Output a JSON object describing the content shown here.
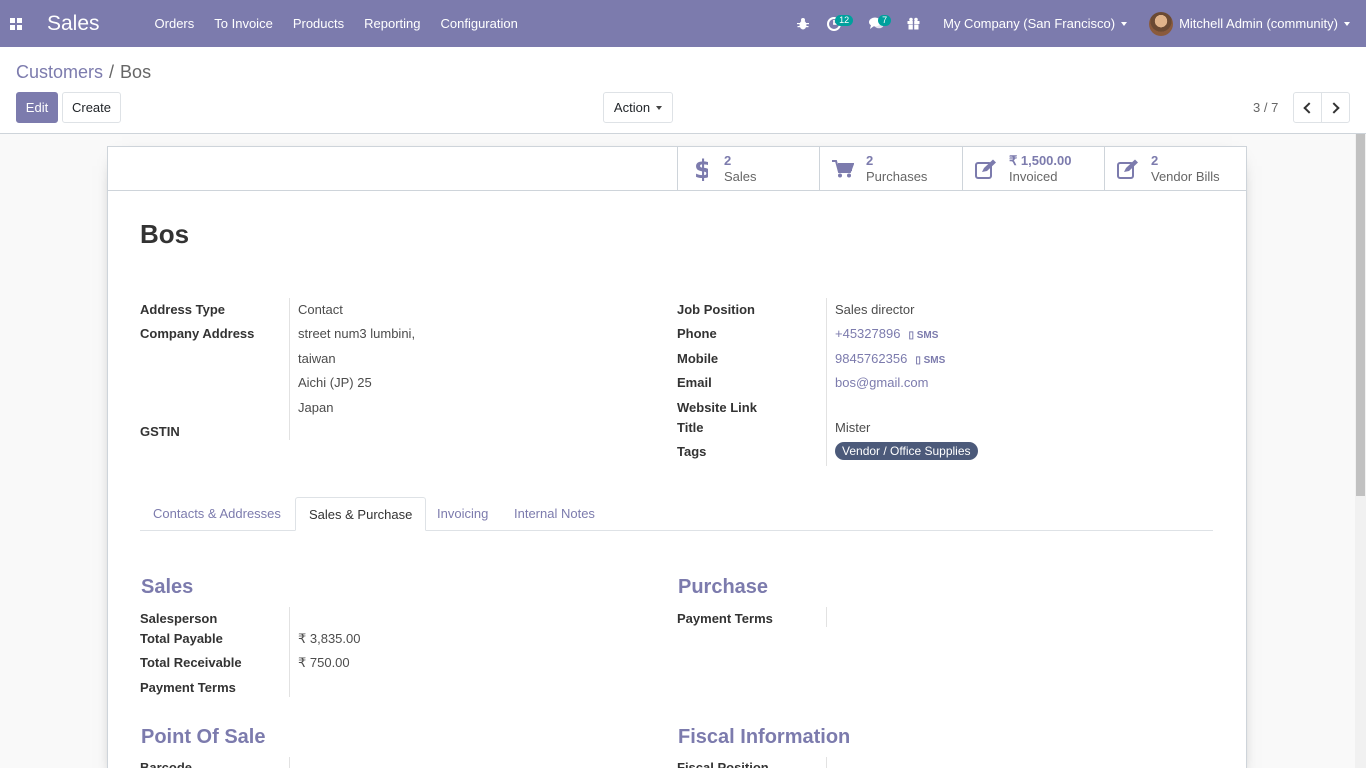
{
  "navbar": {
    "app_name": "Sales",
    "menu": [
      "Orders",
      "To Invoice",
      "Products",
      "Reporting",
      "Configuration"
    ],
    "activity_badge": "12",
    "messages_badge": "7",
    "company": "My Company (San Francisco)",
    "user": "Mitchell Admin (community)"
  },
  "breadcrumb": {
    "parent": "Customers",
    "separator": "/",
    "current": "Bos"
  },
  "toolbar": {
    "edit": "Edit",
    "create": "Create",
    "action": "Action"
  },
  "pager": {
    "value": "3 / 7"
  },
  "smart_buttons": [
    {
      "value": "2",
      "label": "Sales",
      "icon": "dollar-icon"
    },
    {
      "value": "2",
      "label": "Purchases",
      "icon": "cart-icon"
    },
    {
      "value": "₹ 1,500.00",
      "label": "Invoiced",
      "icon": "edit-icon"
    },
    {
      "value": "2",
      "label": "Vendor Bills",
      "icon": "edit-icon"
    }
  ],
  "partner": {
    "name": "Bos",
    "left": {
      "address_type_label": "Address Type",
      "address_type": "Contact",
      "company_address_label": "Company Address",
      "street": "street num3 lumbini,",
      "street2": "taiwan",
      "city_state_zip": "Aichi (JP)  25",
      "country": "Japan",
      "gstin_label": "GSTIN"
    },
    "right": {
      "job_position_label": "Job Position",
      "job_position": "Sales director",
      "phone_label": "Phone",
      "phone": "+45327896",
      "mobile_label": "Mobile",
      "mobile": "9845762356",
      "sms": "SMS",
      "email_label": "Email",
      "email": "bos@gmail.com",
      "website_label": "Website Link",
      "title_label": "Title",
      "title": "Mister",
      "tags_label": "Tags",
      "tag": "Vendor / Office Supplies"
    }
  },
  "tabs": [
    "Contacts & Addresses",
    "Sales & Purchase",
    "Invoicing",
    "Internal Notes"
  ],
  "sales_section": {
    "title": "Sales",
    "salesperson_label": "Salesperson",
    "total_payable_label": "Total Payable",
    "total_payable": "₹ 3,835.00",
    "total_receivable_label": "Total Receivable",
    "total_receivable": "₹ 750.00",
    "payment_terms_label": "Payment Terms"
  },
  "purchase_section": {
    "title": "Purchase",
    "payment_terms_label": "Payment Terms"
  },
  "pos_section": {
    "title": "Point Of Sale",
    "barcode_label": "Barcode"
  },
  "fiscal_section": {
    "title": "Fiscal Information",
    "fiscal_position_label": "Fiscal Position"
  }
}
